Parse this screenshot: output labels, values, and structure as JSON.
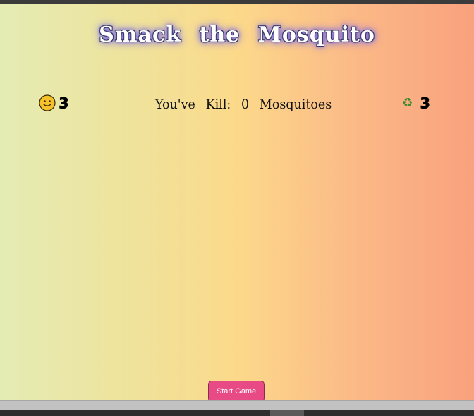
{
  "game": {
    "title": "Smack the Mosquito",
    "lives": {
      "icon": "smiley-icon",
      "count": "3"
    },
    "kill_text": "You've Kill: 0 Mosquitoes",
    "rounds": {
      "icon": "recycle-icon",
      "symbol": "♻",
      "count": "3"
    },
    "start_button": "Start Game"
  },
  "colors": {
    "gradient_left": "#e4ecb4",
    "gradient_mid": "#fcd98a",
    "gradient_right": "#f9a17e",
    "button": "#e84a86",
    "recycle": "#3f8a2a"
  }
}
